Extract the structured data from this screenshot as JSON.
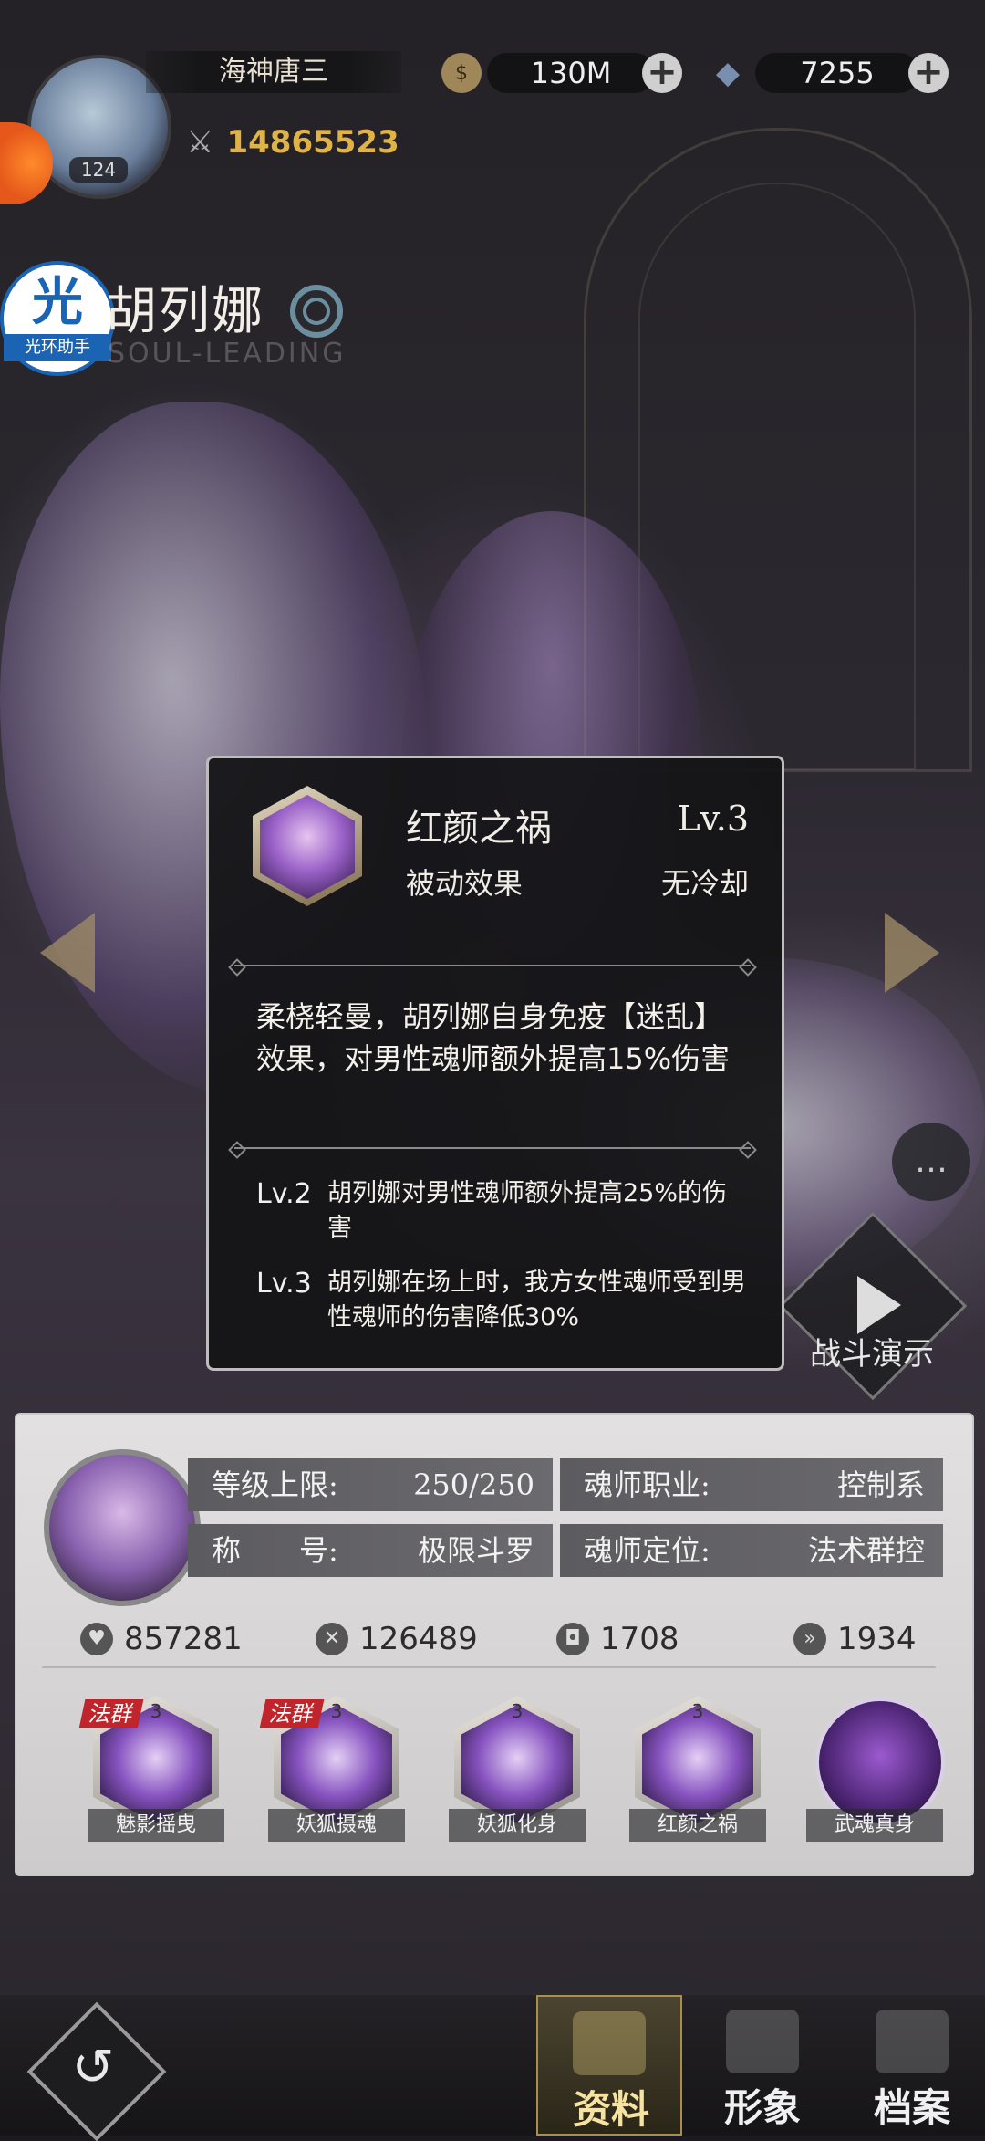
{
  "player": {
    "name": "海神唐三",
    "level": "124",
    "power": "14865523",
    "gold": "130M",
    "diamonds": "7255"
  },
  "helper": {
    "icon_char": "光",
    "label": "光环助手"
  },
  "hero": {
    "name": "胡列娜",
    "subtitle": "SOUL-LEADING"
  },
  "skill_popup": {
    "name": "红颜之祸",
    "level": "Lv.3",
    "type": "被动效果",
    "cooldown": "无冷却",
    "description": "柔桡轻曼，胡列娜自身免疫【迷乱】效果，对男性魂师额外提高15%伤害",
    "upgrades": [
      {
        "level": "Lv.2",
        "text": "胡列娜对男性魂师额外提高25%的伤害"
      },
      {
        "level": "Lv.3",
        "text": "胡列娜在场上时，我方女性魂师受到男性魂师的伤害降低30%"
      }
    ]
  },
  "battle_demo_label": "战斗演示",
  "info": {
    "level_cap_label": "等级上限:",
    "level_cap_value": "250/250",
    "title_label": "称　　号:",
    "title_value": "极限斗罗",
    "class_label": "魂师职业:",
    "class_value": "控制系",
    "role_label": "魂师定位:",
    "role_value": "法术群控"
  },
  "stats": [
    {
      "icon": "hp-icon",
      "value": "857281"
    },
    {
      "icon": "attack-icon",
      "value": "126489"
    },
    {
      "icon": "defense-icon",
      "value": "1708"
    },
    {
      "icon": "speed-icon",
      "value": "1934"
    }
  ],
  "skills": [
    {
      "name": "魅影摇曳",
      "level": "3",
      "tag": "法群"
    },
    {
      "name": "妖狐摄魂",
      "level": "3",
      "tag": "法群"
    },
    {
      "name": "妖狐化身",
      "level": "3",
      "tag": ""
    },
    {
      "name": "红颜之祸",
      "level": "3",
      "tag": ""
    },
    {
      "name": "武魂真身",
      "level": "",
      "tag": ""
    }
  ],
  "nav": {
    "tab_profile": "资料",
    "tab_appearance": "形象",
    "tab_archive": "档案",
    "back_glyph": "↺"
  },
  "colors": {
    "accent_gold": "#e0b347",
    "tag_red": "#c0252b",
    "panel_gray": "#5c5b5f"
  }
}
